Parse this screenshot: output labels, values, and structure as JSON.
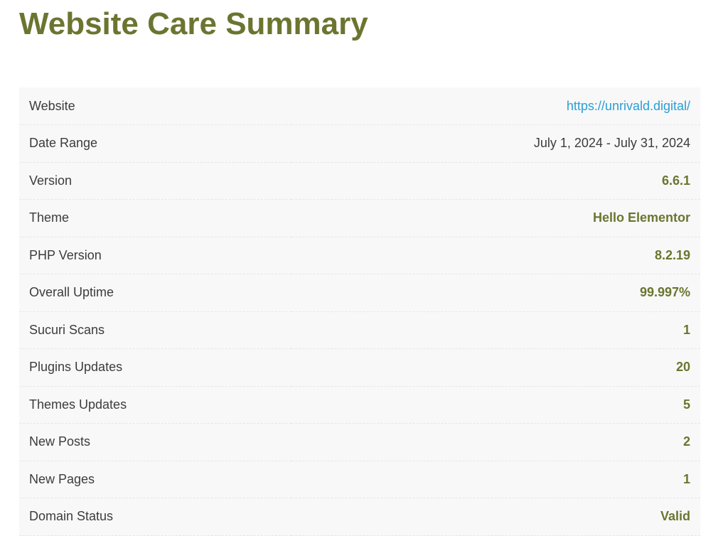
{
  "page": {
    "title": "Website Care Summary"
  },
  "colors": {
    "title": "#6b7530",
    "value_accent": "#6b7530",
    "link": "#2a9fd6",
    "label_text": "#3c3c3c",
    "table_background": "#f8f8f8"
  },
  "summary": {
    "rows": [
      {
        "label": "Website",
        "value": "https://unrivald.digital/",
        "type": "link"
      },
      {
        "label": "Date Range",
        "value": "July 1, 2024 - July 31, 2024",
        "type": "plain"
      },
      {
        "label": "Version",
        "value": "6.6.1",
        "type": "accent"
      },
      {
        "label": "Theme",
        "value": "Hello Elementor",
        "type": "accent"
      },
      {
        "label": "PHP Version",
        "value": "8.2.19",
        "type": "accent"
      },
      {
        "label": "Overall Uptime",
        "value": "99.997%",
        "type": "accent"
      },
      {
        "label": "Sucuri Scans",
        "value": "1",
        "type": "accent"
      },
      {
        "label": "Plugins Updates",
        "value": "20",
        "type": "accent"
      },
      {
        "label": "Themes Updates",
        "value": "5",
        "type": "accent"
      },
      {
        "label": "New Posts",
        "value": "2",
        "type": "accent"
      },
      {
        "label": "New Pages",
        "value": "1",
        "type": "accent"
      },
      {
        "label": "Domain Status",
        "value": "Valid",
        "type": "accent"
      }
    ]
  }
}
